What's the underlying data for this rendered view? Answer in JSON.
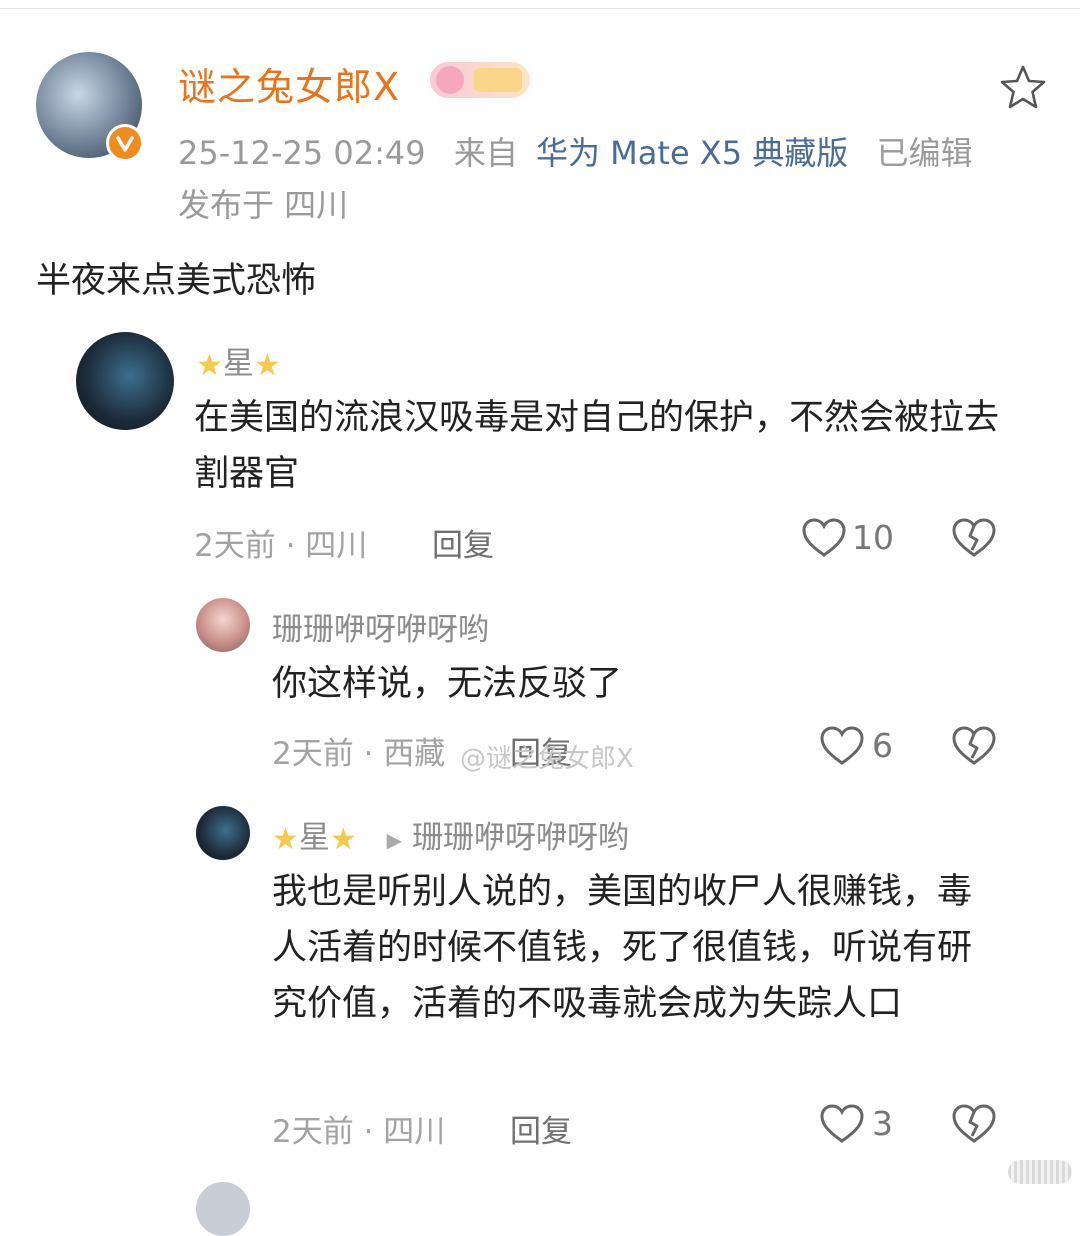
{
  "post": {
    "author": "谜之兔女郎X",
    "timestamp": "25-12-25 02:49",
    "source_prefix": "来自",
    "device": "华为 Mate X5 典藏版",
    "edited": "已编辑",
    "location_label": "发布于 四川",
    "text": "半夜来点美式恐怖"
  },
  "comments": [
    {
      "user": "星",
      "text": "在美国的流浪汉吸毒是对自己的保护，不然会被拉去割器官",
      "meta": "2天前 · 四川",
      "reply_label": "回复",
      "likes": "10"
    },
    {
      "user": "珊珊咿呀咿呀哟",
      "text": "你这样说，无法反驳了",
      "meta": "2天前 · 西藏",
      "reply_label": "回复",
      "likes": "6"
    },
    {
      "user": "星",
      "reply_to": "珊珊咿呀咿呀哟",
      "text": "我也是听别人说的，美国的收尸人很赚钱，毒人活着的时候不值钱，死了很值钱，听说有研究价值，活着的不吸毒就会成为失踪人口",
      "meta": "2天前 · 四川",
      "reply_label": "回复",
      "likes": "3"
    }
  ],
  "watermark": "@谜之兔女郎X",
  "icons": {
    "favorite": "star-outline-icon",
    "like": "heart-outline-icon",
    "dislike": "broken-heart-icon",
    "verified": "verified-badge-icon",
    "reply_arrow": "triangle-right-icon"
  },
  "colors": {
    "author_name": "#e9741c",
    "device_link": "#4a6c99",
    "verified": "#f08c1e"
  }
}
